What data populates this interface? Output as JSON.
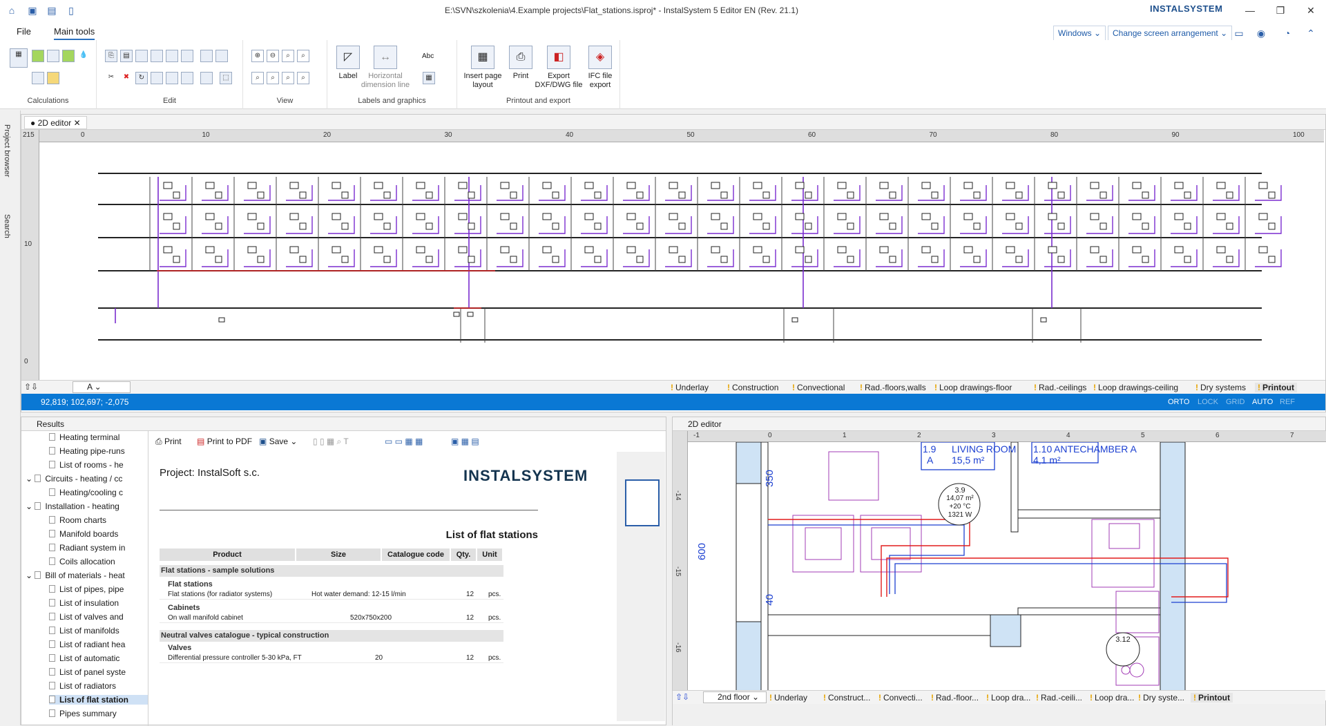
{
  "window": {
    "title": "E:\\SVN\\szkolenia\\4.Example projects\\Flat_stations.isproj* - InstalSystem 5 Editor EN (Rev. 21.1)",
    "brand": "INSTALSYSTEM"
  },
  "menu": {
    "file": "File",
    "main_tools": "Main tools"
  },
  "top_right": {
    "windows": "Windows",
    "screen_arrangement": "Change screen arrangement"
  },
  "ribbon": {
    "groups": {
      "calculations": "Calculations",
      "edit": "Edit",
      "view": "View",
      "labels": "Labels and graphics",
      "printout": "Printout and export"
    },
    "label_btn": "Label",
    "hdim_btn": "Horizontal dimension line",
    "abc": "Abc",
    "insert_page_layout": "Insert page layout",
    "print": "Print",
    "export_dxf": "Export DXF/DWG file",
    "ifc_export": "IFC file export"
  },
  "sidebar": {
    "project_browser": "Project browser",
    "search": "Search"
  },
  "top_editor": {
    "tab": "● 2D editor",
    "ruler_corner": "215",
    "hticks": [
      "0",
      "10",
      "20",
      "30",
      "40",
      "50",
      "60",
      "70",
      "80",
      "90",
      "100"
    ],
    "vticks": [
      "10",
      "0"
    ],
    "floor_select": "A",
    "layers": [
      "Underlay",
      "Construction",
      "Convectional",
      "Rad.-floors,walls",
      "Loop drawings-floor",
      "Rad.-ceilings",
      "Loop drawings-ceiling",
      "Dry systems",
      "Printout"
    ],
    "coords": "92,819; 102,697; -2,075",
    "modes": [
      "ORTO",
      "LOCK",
      "GRID",
      "AUTO",
      "REF"
    ]
  },
  "results": {
    "title": "Results",
    "tree": [
      {
        "label": "Heating terminal",
        "level": 2
      },
      {
        "label": "Heating pipe-runs",
        "level": 2
      },
      {
        "label": "List of rooms - he",
        "level": 2
      },
      {
        "label": "Circuits - heating / cc",
        "level": 1
      },
      {
        "label": "Heating/cooling c",
        "level": 2
      },
      {
        "label": "Installation - heating",
        "level": 1
      },
      {
        "label": "Room charts",
        "level": 2
      },
      {
        "label": "Manifold boards",
        "level": 2
      },
      {
        "label": "Radiant system in",
        "level": 2
      },
      {
        "label": "Coils allocation",
        "level": 2
      },
      {
        "label": "Bill of materials - heat",
        "level": 1
      },
      {
        "label": "List of pipes, pipe",
        "level": 2
      },
      {
        "label": "List of insulation",
        "level": 2
      },
      {
        "label": "List of valves and",
        "level": 2
      },
      {
        "label": "List of manifolds",
        "level": 2
      },
      {
        "label": "List of radiant hea",
        "level": 2
      },
      {
        "label": "List of automatic",
        "level": 2
      },
      {
        "label": "List of panel syste",
        "level": 2
      },
      {
        "label": "List of radiators",
        "level": 2
      },
      {
        "label": "List of flat station",
        "level": 2,
        "selected": true
      },
      {
        "label": "Pipes summary",
        "level": 2
      }
    ],
    "toolbar": {
      "print": "Print",
      "print_pdf": "Print to PDF",
      "save": "Save"
    },
    "report": {
      "project": "Project: InstalSoft s.c.",
      "logo": "INSTALSYSTEM",
      "heading": "List of flat stations",
      "columns": [
        "Product",
        "Size",
        "Catalogue code",
        "Qty.",
        "Unit"
      ],
      "sec1": "Flat stations - sample solutions",
      "sub1": "Flat stations",
      "row1": {
        "product": "Flat stations (for radiator systems)",
        "size": "Hot water demand: 12-15 l/min",
        "qty": "12",
        "unit": "pcs."
      },
      "sub2": "Cabinets",
      "row2": {
        "product": "On wall manifold cabinet",
        "size": "520x750x200",
        "qty": "12",
        "unit": "pcs."
      },
      "sec2": "Neutral valves catalogue - typical construction",
      "sub3": "Valves",
      "row3": {
        "product": "Differential pressure controller 5-30 kPa, FT",
        "size": "20",
        "qty": "12",
        "unit": "pcs."
      }
    }
  },
  "bottom_editor": {
    "tab": "2D editor",
    "hticks": [
      "-1",
      "0",
      "1",
      "2",
      "3",
      "4",
      "5",
      "6",
      "7"
    ],
    "vticks": [
      "-14",
      "-15",
      "-16"
    ],
    "room1": {
      "num": "1.9",
      "name": "LIVING ROOM",
      "cat": "A",
      "area": "15,5 m²"
    },
    "room2": {
      "num": "1.10",
      "name": "ANTECHAMBER A",
      "area": "4,1 m²"
    },
    "zone": {
      "num": "3.9",
      "area": "14,07 m²",
      "temp": "+20 °C",
      "power": "1321 W"
    },
    "zone2": "3.12",
    "dim1": "350",
    "dim2": "600",
    "dim3": "40",
    "floor_select": "2nd floor",
    "layers": [
      "Underlay",
      "Construct...",
      "Convecti...",
      "Rad.-floor...",
      "Loop dra...",
      "Rad.-ceili...",
      "Loop dra...",
      "Dry syste...",
      "Printout"
    ]
  },
  "colors": {
    "accent": "#0a78d4",
    "heating": "#e21b1b",
    "return": "#1b3fd1",
    "riser": "#7a2ccf"
  }
}
